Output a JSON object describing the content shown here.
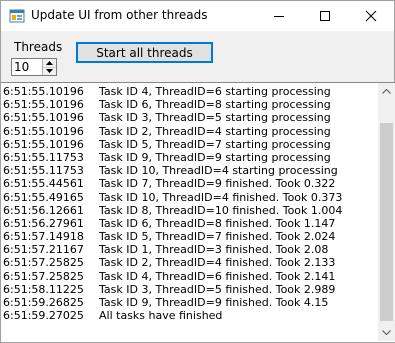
{
  "window": {
    "title": "Update UI from other threads",
    "icon": "windows-form-icon"
  },
  "controls": {
    "minimize_icon": "minimize-icon",
    "maximize_icon": "maximize-icon",
    "close_icon": "close-icon"
  },
  "threads": {
    "label": "Threads",
    "value": "10"
  },
  "start_button": {
    "label": "Start all threads"
  },
  "log": [
    {
      "time": "6:51:55.10196",
      "message": "Task ID 4, ThreadID=6 starting processing"
    },
    {
      "time": "6:51:55.10196",
      "message": "Task ID 6, ThreadID=8 starting processing"
    },
    {
      "time": "6:51:55.10196",
      "message": "Task ID 3, ThreadID=5 starting processing"
    },
    {
      "time": "6:51:55.10196",
      "message": "Task ID 2, ThreadID=4 starting processing"
    },
    {
      "time": "6:51:55.10196",
      "message": "Task ID 5, ThreadID=7 starting processing"
    },
    {
      "time": "6:51:55.11753",
      "message": "Task ID 9, ThreadID=9 starting processing"
    },
    {
      "time": "6:51:55.11753",
      "message": "Task ID 10, ThreadID=4 starting processing"
    },
    {
      "time": "6:51:55.44561",
      "message": "Task ID 7, ThreadID=9 finished. Took 0.322"
    },
    {
      "time": "6:51:55.49165",
      "message": "Task ID 10, ThreadID=4 finished. Took 0.373"
    },
    {
      "time": "6:51:56.12661",
      "message": "Task ID 8, ThreadID=10 finished. Took 1.004"
    },
    {
      "time": "6:51:56.27961",
      "message": "Task ID 6, ThreadID=8 finished. Took 1.147"
    },
    {
      "time": "6:51:57.14918",
      "message": "Task ID 5, ThreadID=7 finished. Took 2.024"
    },
    {
      "time": "6:51:57.21167",
      "message": "Task ID 1, ThreadID=3 finished. Took 2.08"
    },
    {
      "time": "6:51:57.25825",
      "message": "Task ID 2, ThreadID=4 finished. Took 2.133"
    },
    {
      "time": "6:51:57.25825",
      "message": "Task ID 4, ThreadID=6 finished. Took 2.141"
    },
    {
      "time": "6:51:58.11225",
      "message": "Task ID 3, ThreadID=5 finished. Took 2.989"
    },
    {
      "time": "6:51:59.26825",
      "message": "Task ID 9, ThreadID=9 finished. Took 4.15"
    },
    {
      "time": "6:51:59.27025",
      "message": "All tasks have finished"
    }
  ],
  "colors": {
    "button_focus_border": "#0078d7",
    "window_background": "#f0f0f0",
    "list_background": "#ffffff"
  }
}
